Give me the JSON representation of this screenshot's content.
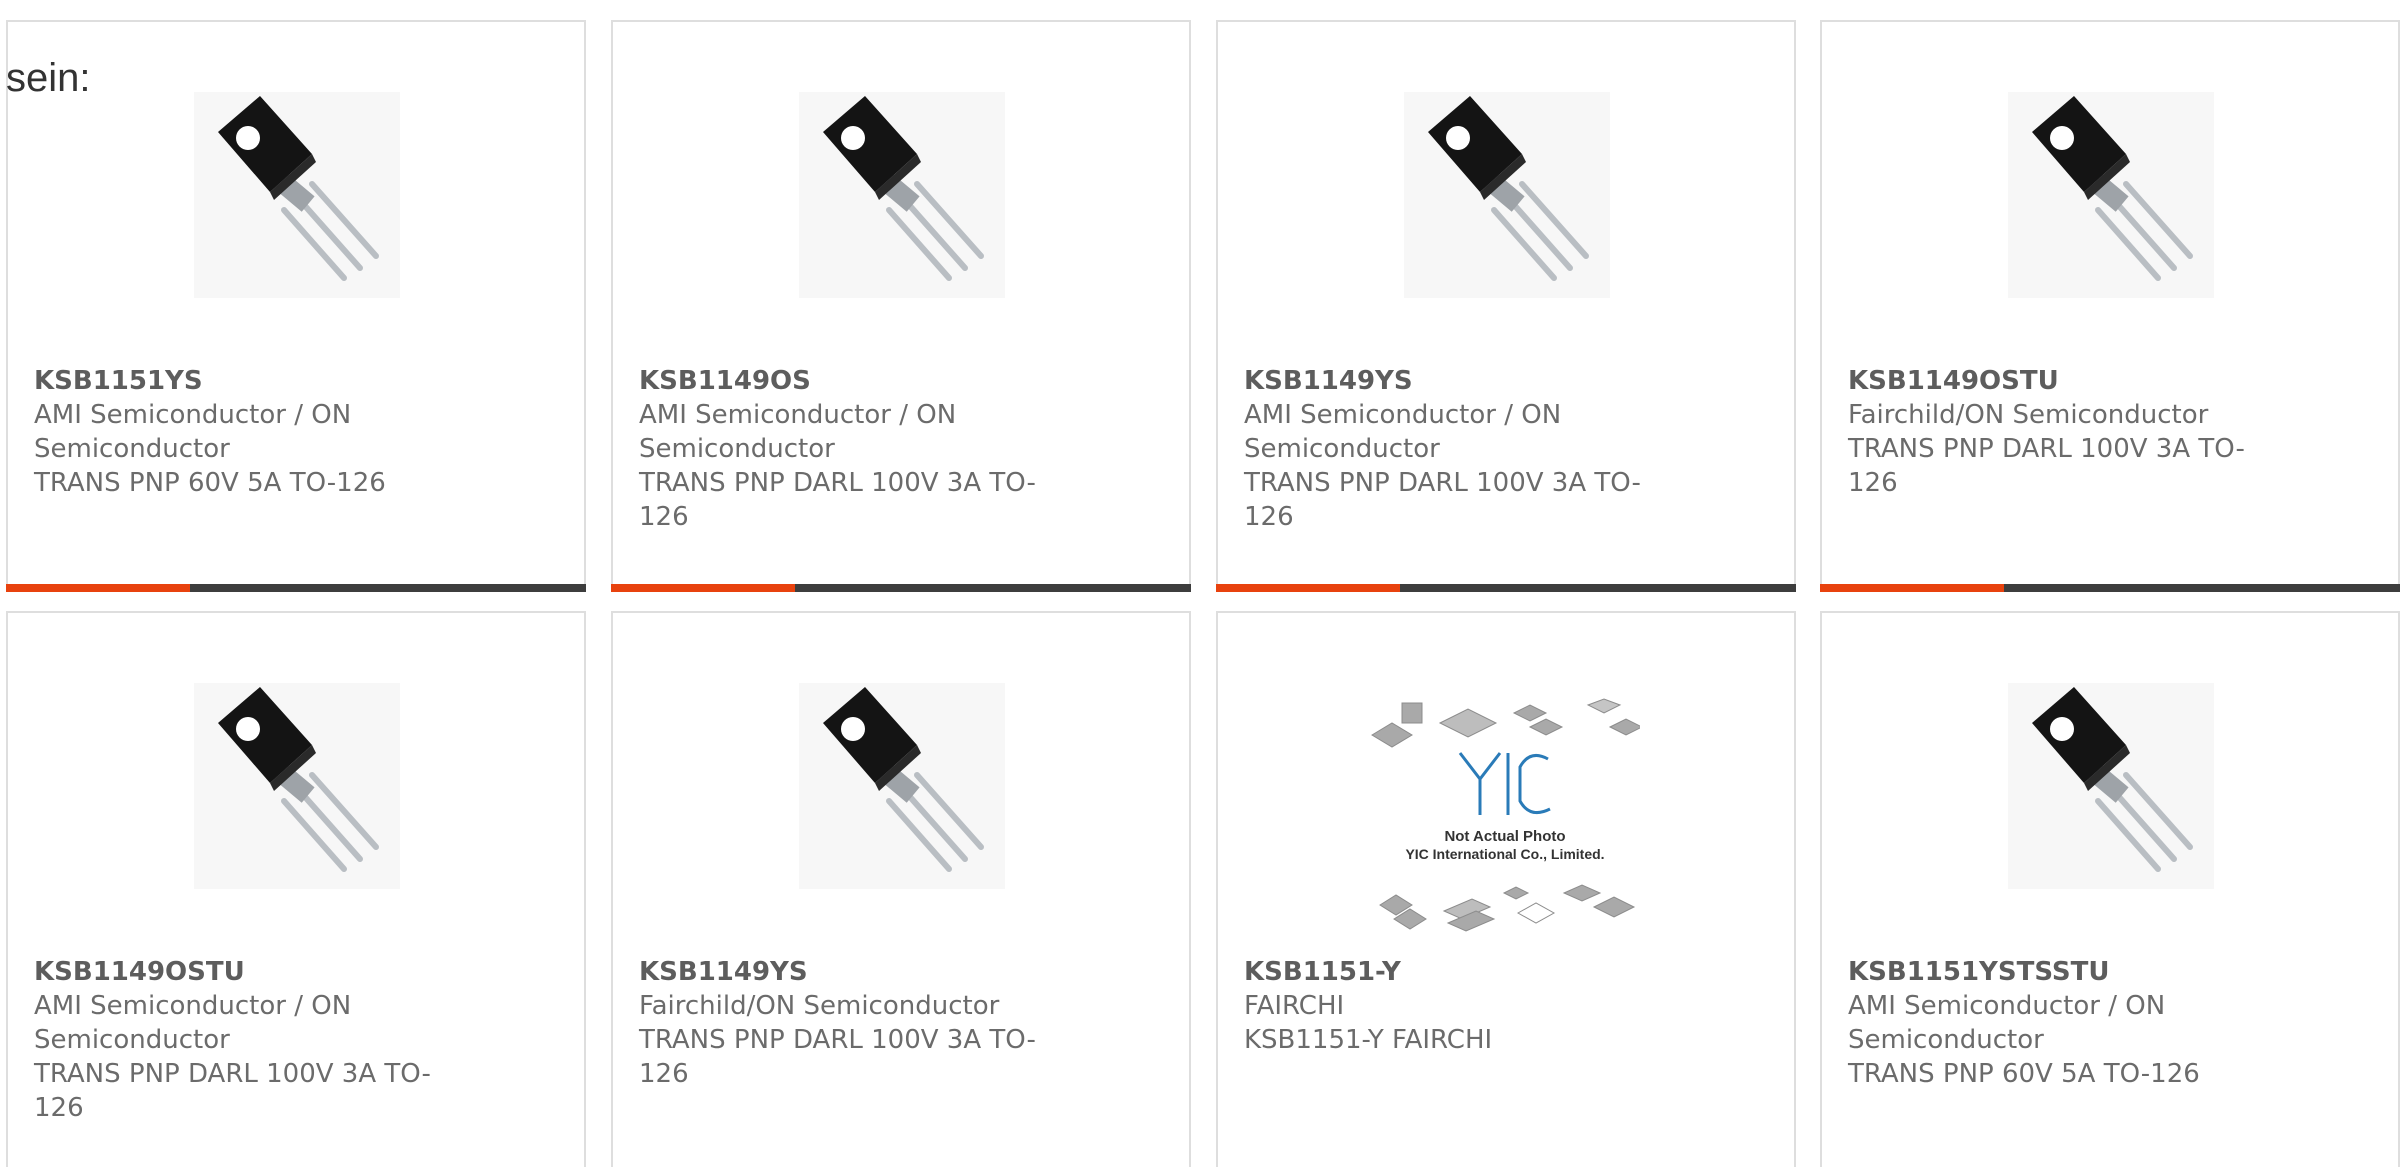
{
  "intro": {
    "text": "sein:"
  },
  "colors": {
    "accent": "#e8420e",
    "bar": "#3d3d3d",
    "border": "#dedede",
    "text": "#6b6b6b"
  },
  "products": [
    {
      "part_number": "KSB1151YS",
      "manufacturer": "AMI Semiconductor / ON Semiconductor",
      "description": "TRANS PNP 60V 5A TO-126",
      "image": "transistor-to126-icon"
    },
    {
      "part_number": "KSB1149OS",
      "manufacturer": "AMI Semiconductor / ON Semiconductor",
      "description": "TRANS PNP DARL 100V 3A TO-126",
      "image": "transistor-to126-icon"
    },
    {
      "part_number": "KSB1149YS",
      "manufacturer": "AMI Semiconductor / ON Semiconductor",
      "description": "TRANS PNP DARL 100V 3A TO-126",
      "image": "transistor-to126-icon"
    },
    {
      "part_number": "KSB1149OSTU",
      "manufacturer": "Fairchild/ON Semiconductor",
      "description": "TRANS PNP DARL 100V 3A TO-126",
      "image": "transistor-to126-icon"
    },
    {
      "part_number": "KSB1149OSTU",
      "manufacturer": "AMI Semiconductor / ON Semiconductor",
      "description": "TRANS PNP DARL 100V 3A TO-126",
      "image": "transistor-to126-icon"
    },
    {
      "part_number": "KSB1149YS",
      "manufacturer": "Fairchild/ON Semiconductor",
      "description": "TRANS PNP DARL 100V 3A TO-126",
      "image": "transistor-to126-icon"
    },
    {
      "part_number": "KSB1151-Y",
      "manufacturer": "FAIRCHI",
      "description": "KSB1151-Y FAIRCHI",
      "image": "yic-placeholder-icon",
      "placeholder_caption_1": "Not Actual Photo",
      "placeholder_caption_2": "YIC International Co., Limited.",
      "placeholder_logo": "YIC"
    },
    {
      "part_number": "KSB1151YSTSSTU",
      "manufacturer": "AMI Semiconductor / ON Semiconductor",
      "description": "TRANS PNP 60V 5A TO-126",
      "image": "transistor-to126-icon"
    }
  ]
}
